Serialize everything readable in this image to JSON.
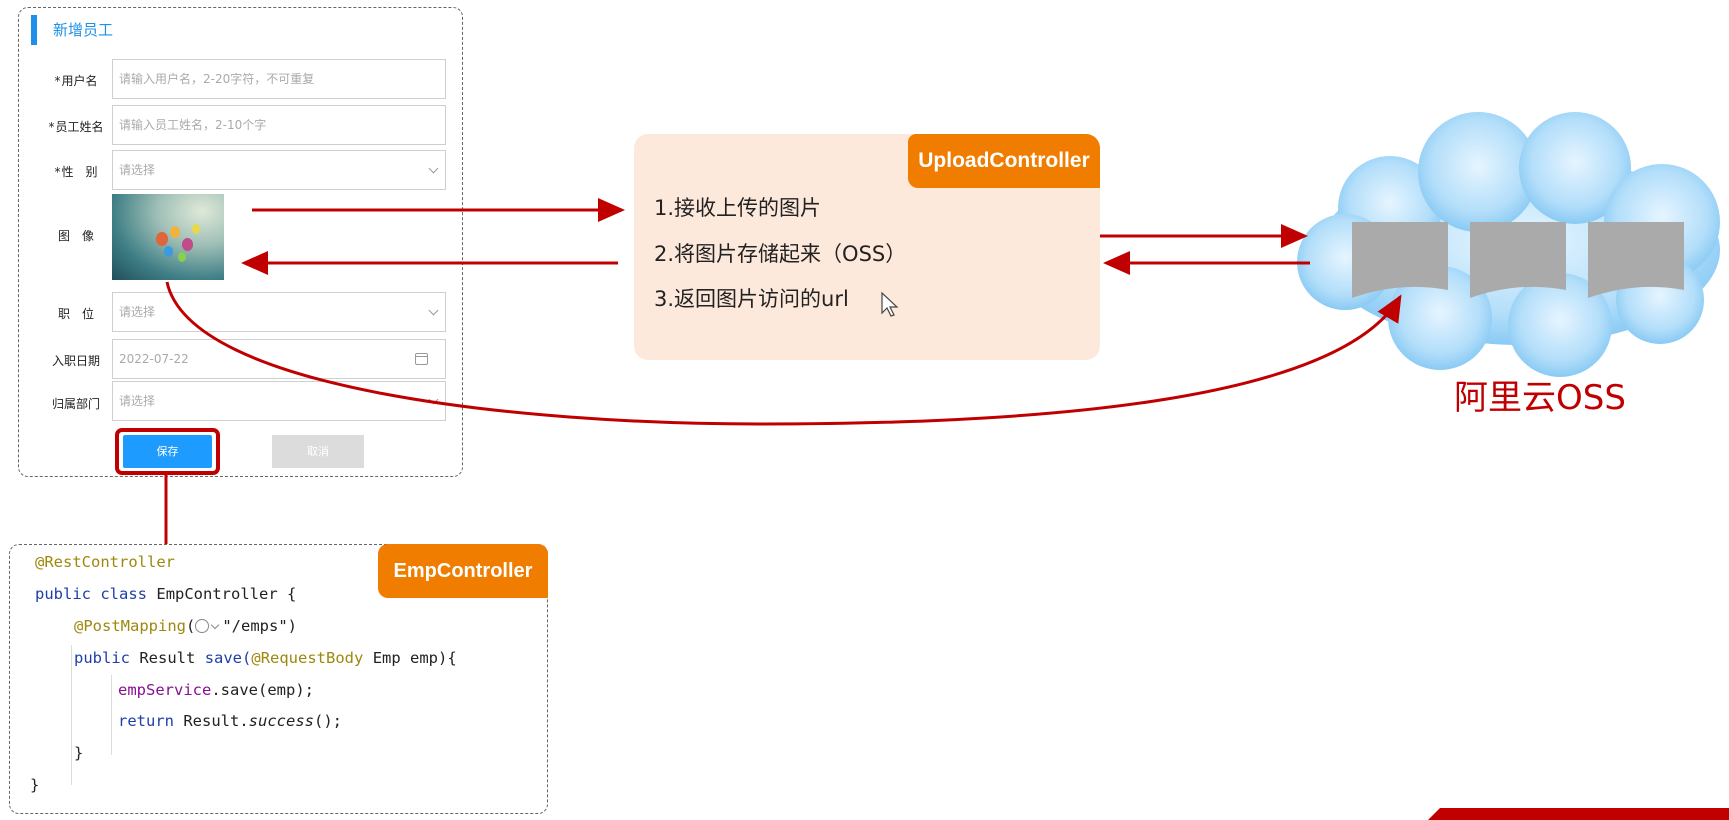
{
  "form": {
    "title": "新增员工",
    "fields": [
      {
        "required": "*",
        "label": "用户名",
        "placeholder": "请输入用户名，2-20字符，不可重复",
        "kind": "input"
      },
      {
        "required": "*",
        "label": "员工姓名",
        "placeholder": "请输入员工姓名，2-10个字",
        "kind": "input"
      },
      {
        "required": "*",
        "label": "性　别",
        "placeholder": "请选择",
        "kind": "select"
      },
      {
        "required": "",
        "label": "图　像",
        "kind": "image"
      },
      {
        "required": "",
        "label": "职　位",
        "placeholder": "请选择",
        "kind": "select"
      },
      {
        "required": "",
        "label": "入职日期",
        "value": "2022-07-22",
        "kind": "date"
      },
      {
        "required": "",
        "label": "归属部门",
        "placeholder": "请选择",
        "kind": "select"
      }
    ],
    "save_label": "保存",
    "cancel_label": "取消"
  },
  "upload_controller": {
    "tag": "UploadController",
    "steps": [
      "1.接收上传的图片",
      "2.将图片存储起来（OSS）",
      "3.返回图片访问的url"
    ]
  },
  "oss": {
    "label": "阿里云OSS"
  },
  "emp_controller": {
    "tag": "EmpController",
    "code": {
      "line1_annotation": "@RestController",
      "line2_kw1": "public",
      "line2_kw2": "class",
      "line2_rest": "EmpController {",
      "line3_annotation": "@PostMapping",
      "line3_paren_open": "(",
      "line3_rest": "\"/emps\")",
      "line4_kw": "public",
      "line4_type": "Result",
      "line4_method": "save(",
      "line4_annotation": "@RequestBody",
      "line4_rest": "Emp emp){",
      "line5_field": "empService",
      "line5_rest": ".save(emp);",
      "line6_kw": "return",
      "line6_obj": "Result.",
      "line6_method": "success",
      "line6_rest": "();",
      "line7": "}",
      "line8": "}"
    }
  },
  "colors": {
    "arrow": "#c00000",
    "tag_orange": "#f07d00",
    "form_accent": "#1e90e8",
    "upload_bg": "#fde9dc",
    "cloud": "#9fd4f7"
  },
  "icons": [
    "calendar-icon",
    "chevron-down-icon",
    "cloud-icon",
    "globe-icon",
    "cursor-icon"
  ]
}
